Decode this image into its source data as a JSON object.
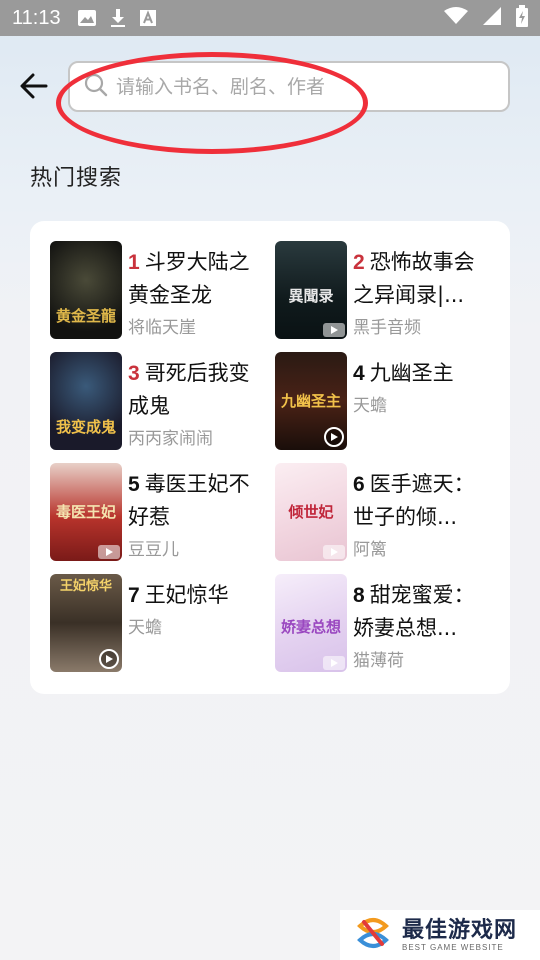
{
  "status_bar": {
    "time": "11:13",
    "left_icons": [
      "image-icon",
      "download-icon",
      "font-icon"
    ],
    "right_icons": [
      "wifi-icon",
      "signal-icon",
      "battery-icon"
    ]
  },
  "search": {
    "placeholder": "请输入书名、剧名、作者",
    "value": ""
  },
  "hot_search": {
    "title": "热门搜索",
    "items": [
      {
        "rank": "1",
        "title": "斗罗大陆之黄金圣龙",
        "author": "将临天崖",
        "cover_text": "黄金圣龍",
        "media_badge": "none"
      },
      {
        "rank": "2",
        "title": "恐怖故事会之异闻录|...",
        "author": "黑手音频",
        "cover_text": "異聞录",
        "media_badge": "play-box"
      },
      {
        "rank": "3",
        "title": "哥死后我变成鬼",
        "author": "丙丙家闹闹",
        "cover_text": "我变成鬼",
        "media_badge": "none"
      },
      {
        "rank": "4",
        "title": "九幽圣主",
        "author": "天蟾",
        "cover_text": "九幽圣主",
        "media_badge": "play-circle"
      },
      {
        "rank": "5",
        "title": "毒医王妃不好惹",
        "author": "豆豆儿",
        "cover_text": "毒医王妃",
        "media_badge": "play-box"
      },
      {
        "rank": "6",
        "title": "医手遮天：世子的倾...",
        "author": "阿篱",
        "cover_text": "倾世妃",
        "media_badge": "play-box"
      },
      {
        "rank": "7",
        "title": "王妃惊华",
        "author": "天蟾",
        "cover_text": "王妃惊华",
        "media_badge": "play-circle"
      },
      {
        "rank": "8",
        "title": "甜宠蜜爱：娇妻总想...",
        "author": "猫薄荷",
        "cover_text": "娇妻总想",
        "media_badge": "play-box"
      }
    ]
  },
  "watermark": {
    "main": "最佳游戏网",
    "sub": "BEST GAME WEBSITE"
  },
  "colors": {
    "rank_hot": "#c9323c",
    "annotation_red": "#ef2f3a",
    "status_bar": "#9a9a9a"
  }
}
